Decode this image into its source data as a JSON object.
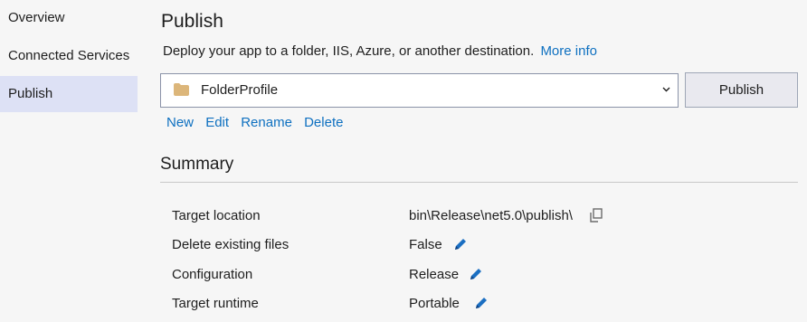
{
  "sidebar": {
    "items": [
      {
        "label": "Overview"
      },
      {
        "label": "Connected Services"
      },
      {
        "label": "Publish"
      }
    ]
  },
  "page": {
    "title": "Publish",
    "description": "Deploy your app to a folder, IIS, Azure, or another destination.",
    "more_info": "More info"
  },
  "profile": {
    "selected": "FolderProfile",
    "icon": "folder-icon"
  },
  "publish_button": "Publish",
  "actions": {
    "new": "New",
    "edit": "Edit",
    "rename": "Rename",
    "delete": "Delete"
  },
  "summary": {
    "title": "Summary",
    "rows": [
      {
        "label": "Target location",
        "value": "bin\\Release\\net5.0\\publish\\",
        "icon": "copy-icon"
      },
      {
        "label": "Delete existing files",
        "value": "False",
        "icon": "edit-pencil-icon"
      },
      {
        "label": "Configuration",
        "value": "Release",
        "icon": "edit-pencil-icon"
      },
      {
        "label": "Target runtime",
        "value": "Portable",
        "icon": "edit-pencil-icon"
      }
    ]
  },
  "colors": {
    "link": "#0e70c0",
    "selected_nav": "#dde1f5",
    "background": "#f6f6f6"
  }
}
